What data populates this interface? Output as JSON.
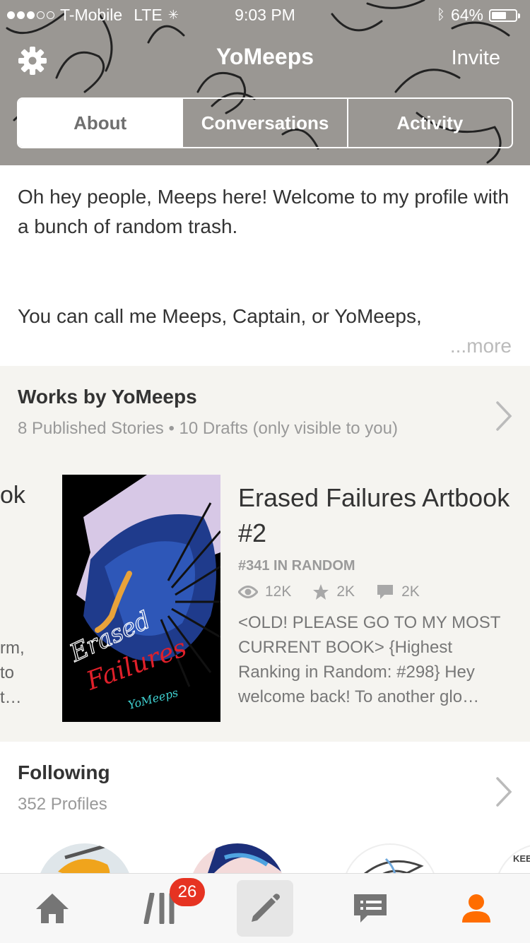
{
  "status_bar": {
    "carrier": "T-Mobile",
    "network": "LTE",
    "time": "9:03 PM",
    "battery": "64%",
    "battery_level": 0.64,
    "signal_bars": 3,
    "signal_total": 5
  },
  "nav": {
    "title": "YoMeeps",
    "invite": "Invite",
    "settings_icon": "gear-icon"
  },
  "tabs": [
    {
      "label": "About",
      "active": true
    },
    {
      "label": "Conversations",
      "active": false
    },
    {
      "label": "Activity",
      "active": false
    }
  ],
  "about": {
    "line1": "Oh hey people, Meeps here! Welcome to my profile with a bunch of random trash.",
    "line2": "You can call me Meeps, Captain, or YoMeeps,",
    "more": "...more"
  },
  "works": {
    "title": "Works by YoMeeps",
    "subtitle": "8 Published Stories • 10 Drafts (only visible to you)",
    "peek_title": "ok",
    "peek_lines": [
      "rm,",
      "to",
      "t…"
    ],
    "book": {
      "title": "Erased Failures Artbook #2",
      "rank": "#341 IN RANDOM",
      "reads": "12K",
      "votes": "2K",
      "comments": "2K",
      "description": "<OLD! PLEASE GO TO MY MOST CURRENT BOOK> {Highest Ranking in Random: #298} Hey welcome back! To another glo…",
      "cover_text_1": "Erased",
      "cover_text_2": "Failures",
      "cover_signature": "YoMeeps"
    }
  },
  "following": {
    "title": "Following",
    "subtitle": "352 Profiles",
    "avatar_text": "KEE"
  },
  "tabbar": {
    "badge": "26",
    "items": [
      "home-icon",
      "library-icon",
      "write-icon",
      "messages-icon",
      "profile-icon"
    ]
  },
  "colors": {
    "header_bg": "#9a9793",
    "accent": "#ff6d00",
    "badge": "#e63322",
    "works_bg": "#f5f4f0"
  }
}
